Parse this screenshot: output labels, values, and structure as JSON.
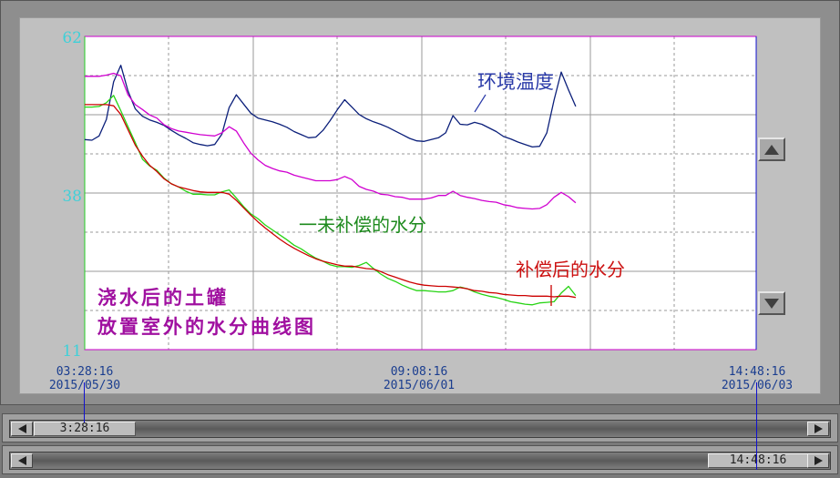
{
  "colors": {
    "plot_bg": "#ffffff",
    "grid": "#9a9a9a",
    "axis_border": "#cc00cc",
    "tick_label": "#3fd0d8",
    "temperature": "#0b1f7a",
    "uncompensated": "#27d414",
    "compensated": "#cc0000",
    "magenta_series": "#d000d0",
    "annotation_purple": "#a010a0",
    "cursor": "#1010d0"
  },
  "chart_data": {
    "type": "line",
    "title": "浇水后的土罐放置室外的水分曲线图",
    "title_lines": [
      "浇水后的土罐",
      "放置室外的水分曲线图"
    ],
    "ylim": [
      11,
      62
    ],
    "y_ticks": [
      "62",
      "38",
      "11"
    ],
    "x_ticks": [
      {
        "time": "03:28:16",
        "date": "2015/05/30"
      },
      {
        "time": "09:08:16",
        "date": "2015/06/01"
      },
      {
        "time": "14:48:16",
        "date": "2015/06/03"
      }
    ],
    "x": [
      0,
      2,
      4,
      6,
      8,
      10,
      12,
      14,
      16,
      18,
      20,
      22,
      24,
      26,
      28,
      30,
      32,
      34,
      36,
      38,
      40,
      42,
      44,
      46,
      48,
      50,
      52,
      54,
      56,
      58,
      60,
      62,
      64,
      66,
      68,
      70,
      72,
      74,
      76,
      78,
      80,
      82,
      84,
      86,
      88,
      90,
      92,
      94,
      96,
      98,
      100,
      102,
      104,
      106,
      108,
      110,
      112,
      114,
      116,
      118,
      120,
      122,
      124,
      126,
      128,
      130,
      132,
      134,
      136,
      138,
      140,
      142,
      144,
      146,
      148,
      150,
      152,
      154,
      156,
      158,
      160,
      162,
      164,
      166,
      168,
      170,
      172,
      174,
      176,
      178,
      180,
      182,
      184,
      186
    ],
    "series": [
      {
        "name": "环境温度",
        "values": [
          45.2,
          45.1,
          45.8,
          48.5,
          54.6,
          57.3,
          53.1,
          50.2,
          49.0,
          48.4,
          48.0,
          47.5,
          46.7,
          46.0,
          45.4,
          44.7,
          44.4,
          44.2,
          44.4,
          46.1,
          50.4,
          52.5,
          51.0,
          49.5,
          48.7,
          48.4,
          48.1,
          47.7,
          47.2,
          46.5,
          46.0,
          45.5,
          45.6,
          46.7,
          48.3,
          50.1,
          51.7,
          50.5,
          49.3,
          48.6,
          48.1,
          47.7,
          47.2,
          46.6,
          46.0,
          45.4,
          45.0,
          44.9,
          45.2,
          45.5,
          46.3,
          49.1,
          47.7,
          47.6,
          48.0,
          47.7,
          47.1,
          46.5,
          45.7,
          45.3,
          44.8,
          44.4,
          44.0,
          44.1,
          46.3,
          51.6,
          56.2,
          53.3,
          50.6
        ]
      },
      {
        "name": "",
        "values": [
          55.5,
          55.5,
          55.5,
          55.7,
          56.0,
          55.6,
          52.5,
          50.9,
          50.1,
          49.2,
          48.7,
          47.6,
          47.0,
          46.6,
          46.4,
          46.2,
          46.0,
          45.9,
          45.8,
          46.3,
          47.3,
          46.6,
          44.7,
          43.0,
          41.9,
          41.0,
          40.5,
          40.1,
          39.9,
          39.4,
          39.1,
          38.8,
          38.5,
          38.5,
          38.5,
          38.7,
          39.2,
          38.7,
          37.6,
          37.1,
          36.8,
          36.3,
          36.2,
          35.9,
          35.8,
          35.5,
          35.5,
          35.5,
          35.7,
          36.1,
          36.1,
          36.8,
          36.1,
          35.8,
          35.6,
          35.3,
          35.1,
          35.0,
          34.6,
          34.4,
          34.1,
          34.0,
          33.9,
          34.0,
          34.6,
          35.8,
          36.6,
          35.9,
          34.9
        ]
      },
      {
        "name": "未补偿的水分",
        "values": [
          50.5,
          50.5,
          50.6,
          51.2,
          52.4,
          49.9,
          47.3,
          44.7,
          42.0,
          40.9,
          40.2,
          38.9,
          38.0,
          37.5,
          36.8,
          36.3,
          36.3,
          36.2,
          36.2,
          36.7,
          37.0,
          35.7,
          34.3,
          33.1,
          32.3,
          31.3,
          30.5,
          29.7,
          28.9,
          28.0,
          27.4,
          26.6,
          25.9,
          25.4,
          24.8,
          24.5,
          24.5,
          24.4,
          24.7,
          25.2,
          24.2,
          23.3,
          22.6,
          22.1,
          21.5,
          21.0,
          20.6,
          20.6,
          20.5,
          20.4,
          20.4,
          20.6,
          21.2,
          20.9,
          20.4,
          20.0,
          19.7,
          19.5,
          19.2,
          18.8,
          18.6,
          18.4,
          18.3,
          18.6,
          18.7,
          18.8,
          20.2,
          21.3,
          19.8
        ]
      },
      {
        "name": "补偿后的水分",
        "values": [
          50.9,
          50.9,
          50.9,
          50.9,
          50.7,
          49.3,
          46.8,
          44.3,
          42.5,
          41.0,
          40.0,
          38.8,
          38.0,
          37.5,
          37.2,
          36.9,
          36.7,
          36.6,
          36.6,
          36.6,
          36.3,
          35.3,
          34.1,
          32.9,
          31.8,
          30.8,
          29.9,
          29.0,
          28.2,
          27.5,
          26.9,
          26.3,
          25.8,
          25.4,
          25.1,
          24.8,
          24.6,
          24.6,
          24.4,
          24.2,
          24.1,
          23.7,
          23.2,
          22.8,
          22.4,
          22.0,
          21.7,
          21.5,
          21.4,
          21.3,
          21.3,
          21.2,
          21.1,
          20.9,
          20.6,
          20.5,
          20.3,
          20.2,
          20.0,
          19.9,
          19.8,
          19.8,
          19.7,
          19.7,
          19.7,
          19.6,
          19.7,
          19.7,
          19.5
        ]
      }
    ],
    "annotations": {
      "temperature": "环境温度",
      "uncompensated": "一未补偿的水分",
      "compensated": "补偿后的水分"
    },
    "grid": true
  },
  "controls": {
    "up_icon": "triangle-up-icon",
    "down_icon": "triangle-down-icon"
  },
  "scrollbars": {
    "start": {
      "value": "3:28:16",
      "position": 0.0
    },
    "end": {
      "value": "14:48:16",
      "position": 1.0
    }
  }
}
